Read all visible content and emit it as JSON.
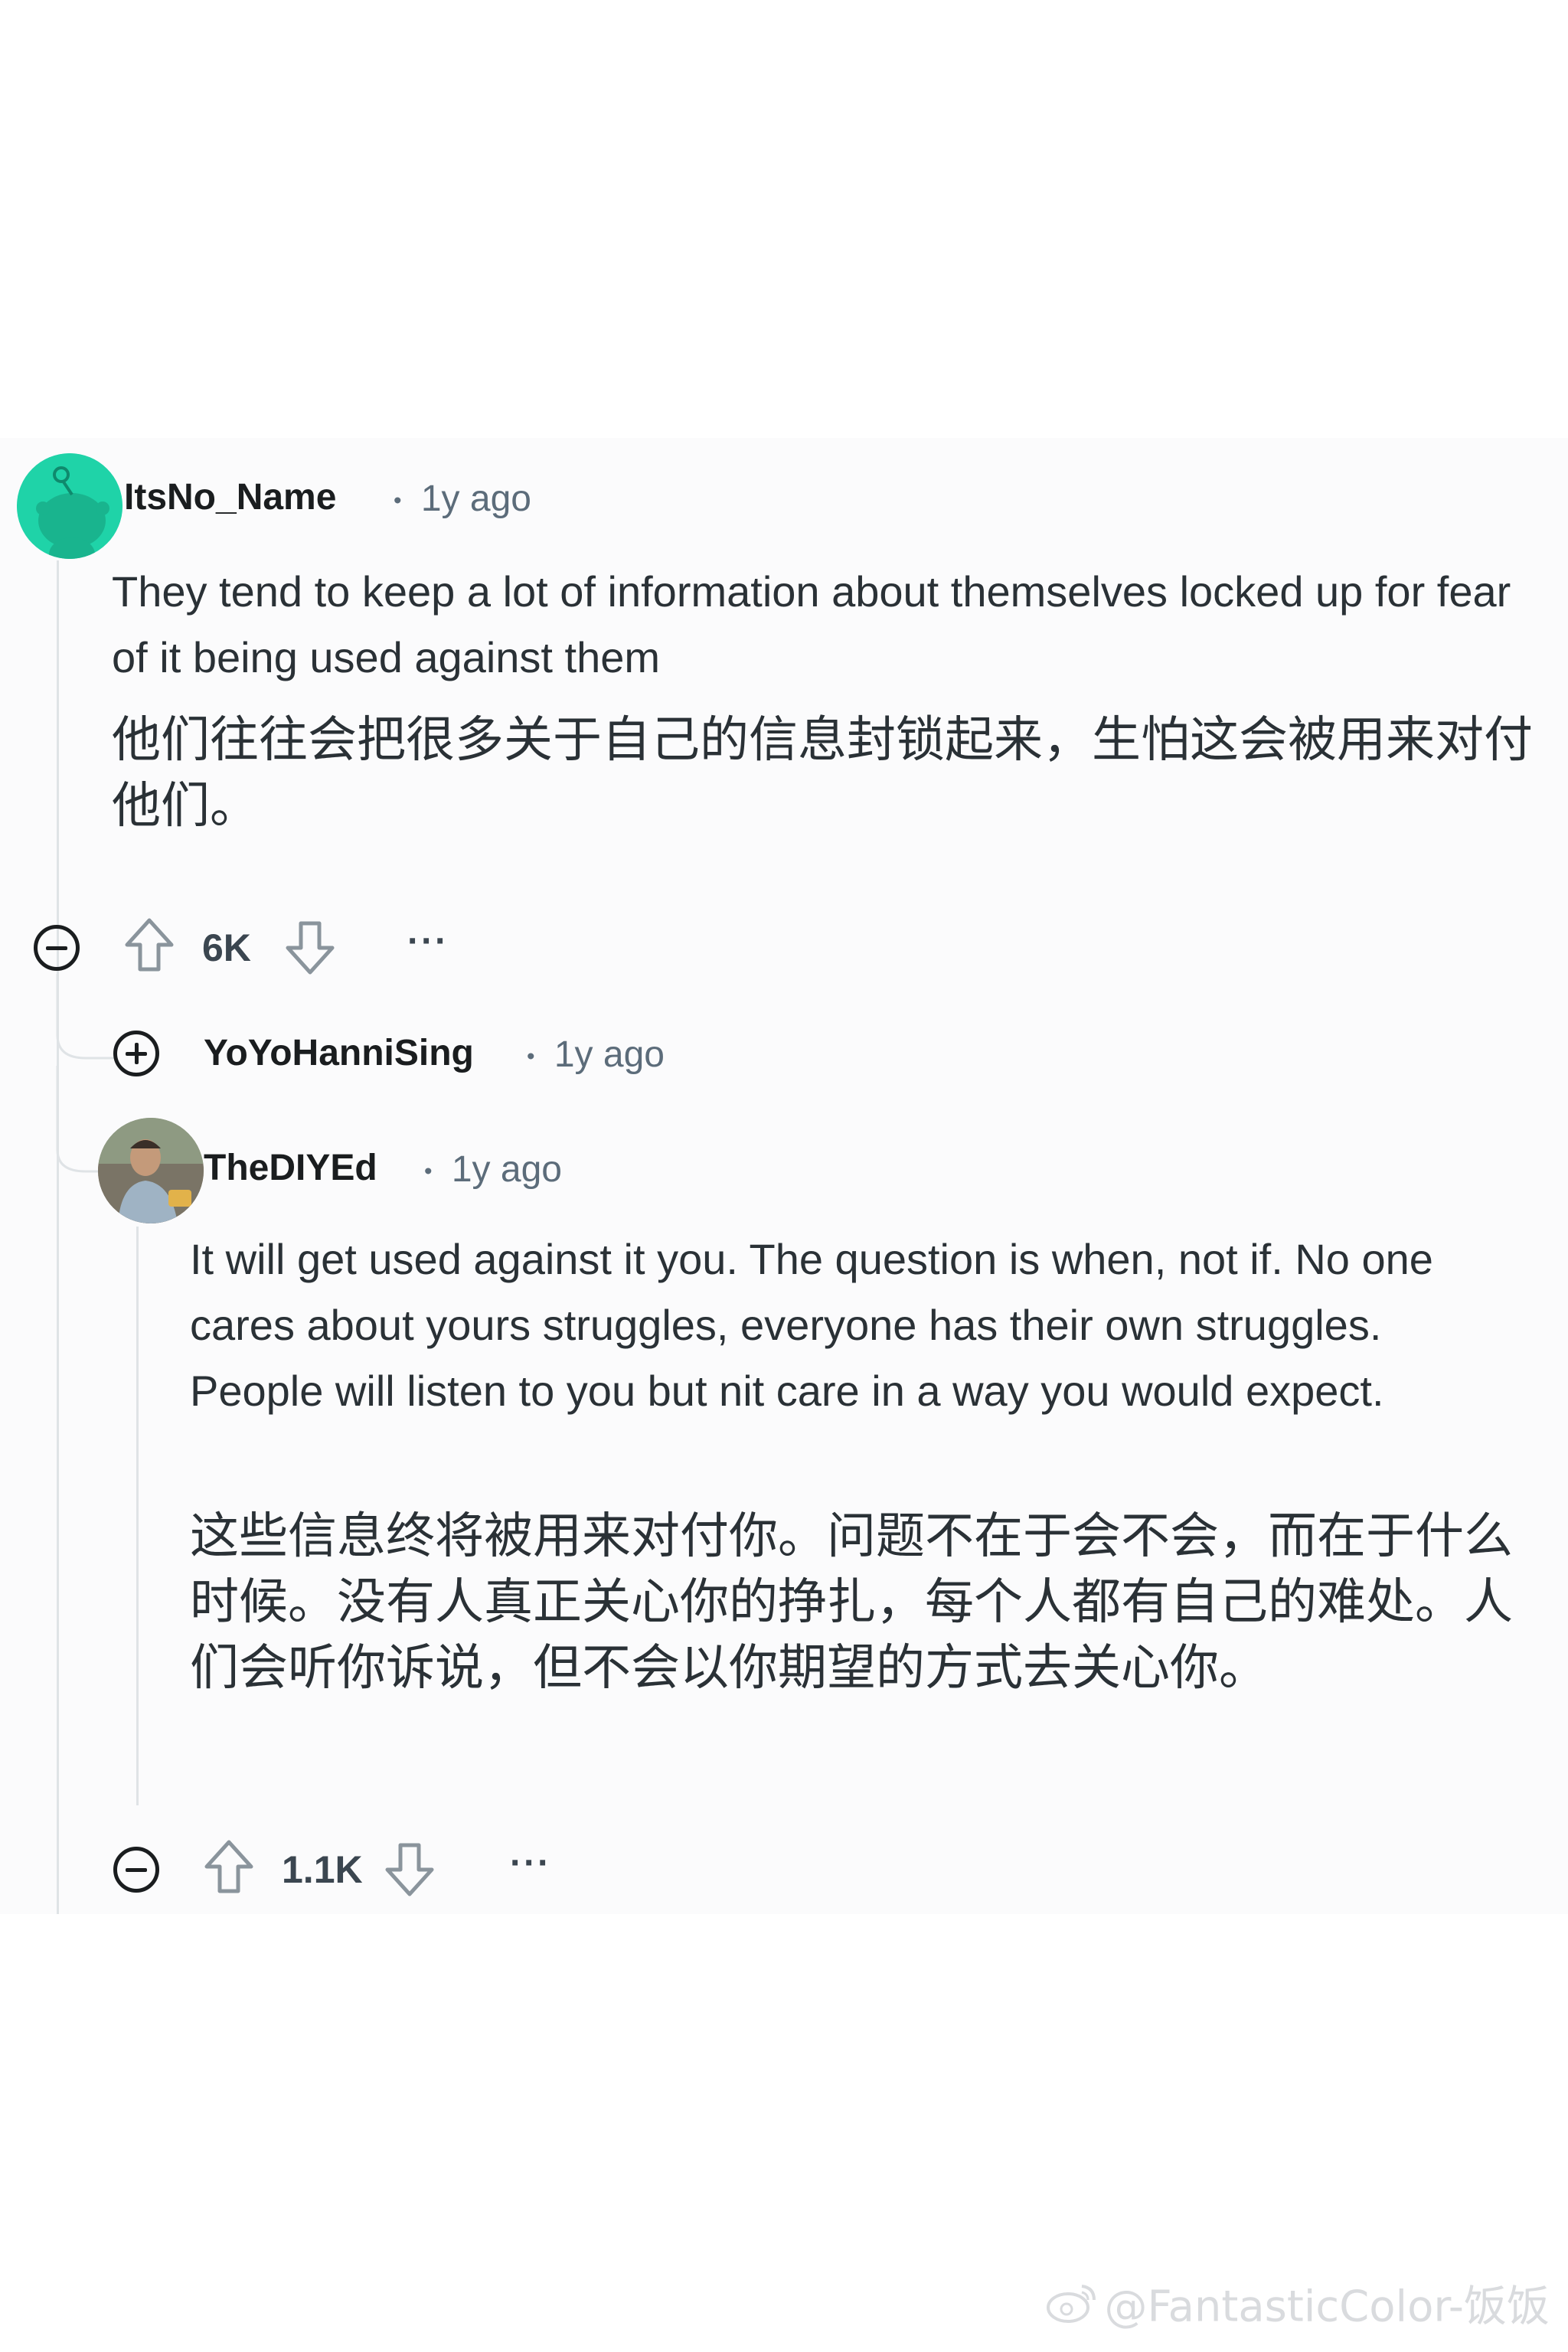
{
  "comments": [
    {
      "username": "ItsNo_Name",
      "time": "1y ago",
      "text_en": "They tend to keep a lot of information about themselves locked up for fear of it being used against them",
      "text_zh": "他们往往会把很多关于自己的信息封锁起来，生怕这会被用来对付他们。",
      "votes": "6K"
    },
    {
      "username": "YoYoHanniSing",
      "time": "1y ago",
      "collapsed": true
    },
    {
      "username": "TheDIYEd",
      "time": "1y ago",
      "text_en": "It will get used against it you. The question is when, not if. No one cares about yours struggles, everyone has their own struggles. People will listen to you but nit care in a way you would expect.",
      "text_zh": "这些信息终将被用来对付你。问题不在于会不会，而在于什么时候。没有人真正关心你的挣扎，每个人都有自己的难处。人们会听你诉说，但不会以你期望的方式去关心你。",
      "votes": "1.1K"
    }
  ],
  "meta_separator": "•",
  "more_label": "···",
  "watermark": "@FantasticColor-饭饭",
  "colors": {
    "snoo_avatar": "#1fd3a8",
    "meta_text": "#5c6c7a",
    "thread_line": "#dfe3e6"
  },
  "icons": [
    "snoo-avatar",
    "user-photo-avatar",
    "collapse-icon",
    "expand-icon",
    "upvote-icon",
    "downvote-icon",
    "more-icon",
    "weibo-icon"
  ]
}
